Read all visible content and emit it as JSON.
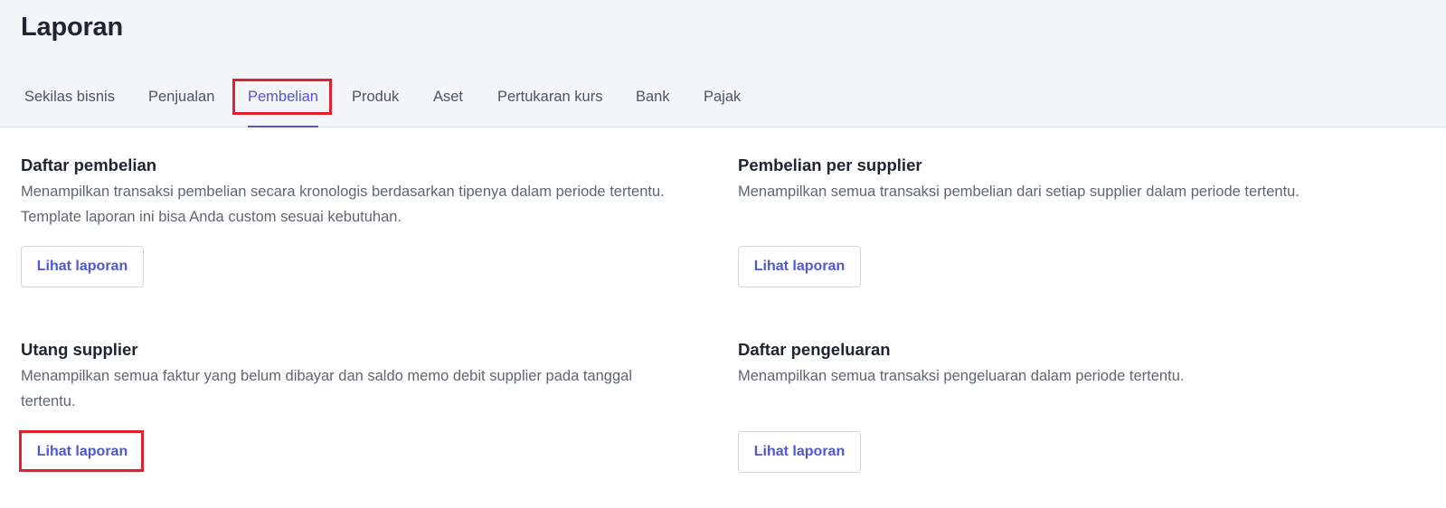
{
  "page": {
    "title": "Laporan"
  },
  "tabs": [
    {
      "label": "Sekilas bisnis",
      "active": false
    },
    {
      "label": "Penjualan",
      "active": false
    },
    {
      "label": "Pembelian",
      "active": true
    },
    {
      "label": "Produk",
      "active": false
    },
    {
      "label": "Aset",
      "active": false
    },
    {
      "label": "Pertukaran kurs",
      "active": false
    },
    {
      "label": "Bank",
      "active": false
    },
    {
      "label": "Pajak",
      "active": false
    }
  ],
  "reports": [
    {
      "title": "Daftar pembelian",
      "description": "Menampilkan transaksi pembelian secara kronologis berdasarkan tipenya dalam periode tertentu. Template laporan ini bisa Anda custom sesuai kebutuhan.",
      "button_label": "Lihat laporan"
    },
    {
      "title": "Pembelian per supplier",
      "description": "Menampilkan semua transaksi pembelian dari setiap supplier dalam periode tertentu.",
      "button_label": "Lihat laporan"
    },
    {
      "title": "Utang supplier",
      "description": "Menampilkan semua faktur yang belum dibayar dan saldo memo debit supplier pada tanggal tertentu.",
      "button_label": "Lihat laporan"
    },
    {
      "title": "Daftar pengeluaran",
      "description": "Menampilkan semua transaksi pengeluaran dalam periode tertentu.",
      "button_label": "Lihat laporan"
    }
  ],
  "colors": {
    "accent": "#4f57d1",
    "highlight": "#e3212d",
    "header_bg": "#f3f5f9"
  }
}
